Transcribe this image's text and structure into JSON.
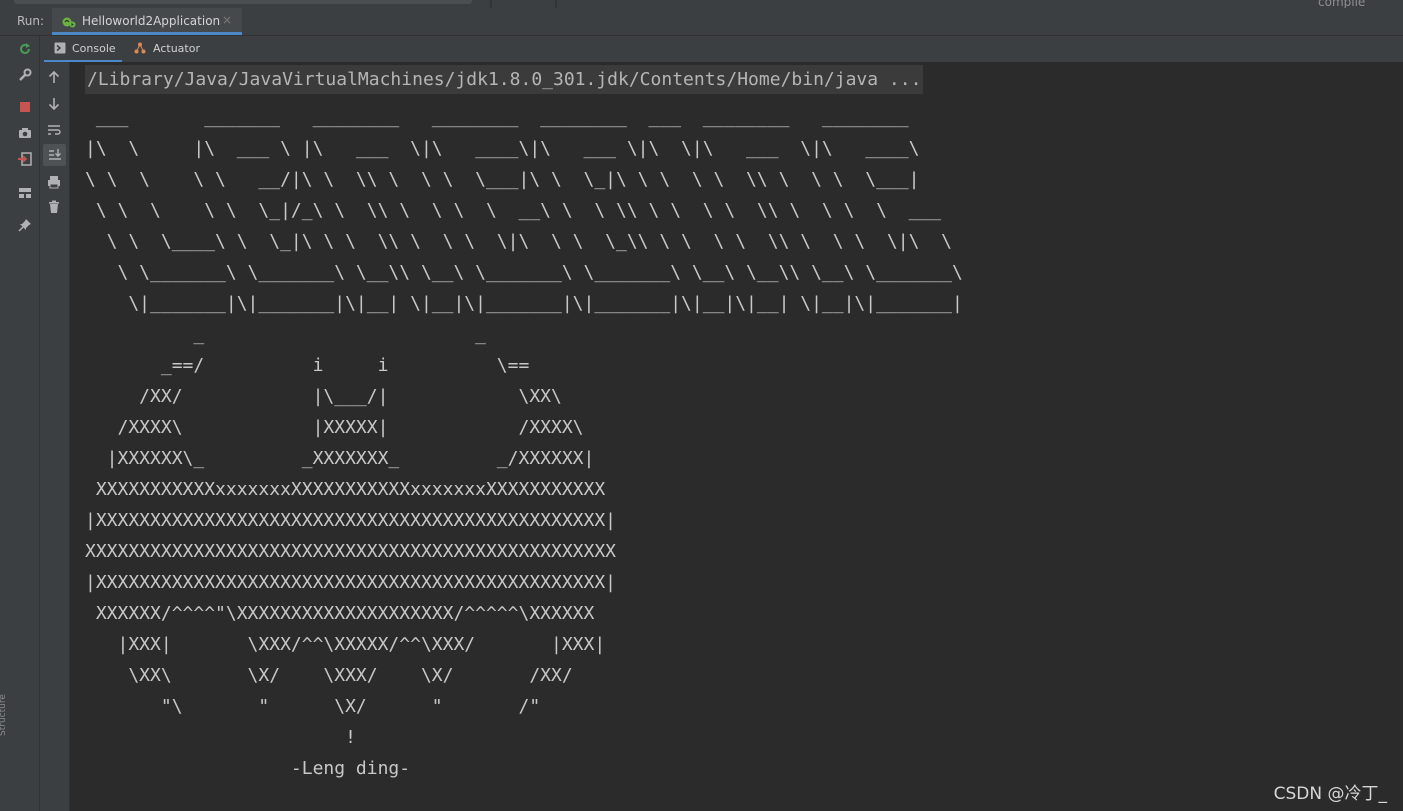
{
  "top": {
    "partial_label": "compile"
  },
  "run_bar": {
    "label": "Run:",
    "tab_title": "Helloworld2Application",
    "close_glyph": "×"
  },
  "sub_tabs": [
    {
      "label": "Console",
      "icon": "console-icon",
      "active": true
    },
    {
      "label": "Actuator",
      "icon": "actuator-icon",
      "active": false
    }
  ],
  "left_strip": {
    "label": "Structure"
  },
  "console": {
    "command": "/Library/Java/JavaVirtualMachines/jdk1.8.0_301.jdk/Contents/Home/bin/java ...",
    "banner": " ___       _______   ________   ________  ________  ___  ________   ________\n|\\  \\     |\\  ___ \\ |\\   ___  \\|\\   ____\\|\\   ___ \\|\\  \\|\\   ___  \\|\\   ____\\\n\\ \\  \\    \\ \\   __/|\\ \\  \\\\ \\  \\ \\  \\___|\\ \\  \\_|\\ \\ \\  \\ \\  \\\\ \\  \\ \\  \\___|\n \\ \\  \\    \\ \\  \\_|/_\\ \\  \\\\ \\  \\ \\  \\  __\\ \\  \\ \\\\ \\ \\  \\ \\  \\\\ \\  \\ \\  \\  ___\n  \\ \\  \\____\\ \\  \\_|\\ \\ \\  \\\\ \\  \\ \\  \\|\\  \\ \\  \\_\\\\ \\ \\  \\ \\  \\\\ \\  \\ \\  \\|\\  \\\n   \\ \\_______\\ \\_______\\ \\__\\\\ \\__\\ \\_______\\ \\_______\\ \\__\\ \\__\\\\ \\__\\ \\_______\\\n    \\|_______|\\|_______|\\|__| \\|__|\\|_______|\\|_______|\\|__|\\|__| \\|__|\\|_______|\n          _                         _\n       _==/          i     i          \\==\n     /XX/            |\\___/|            \\XX\\\n   /XXXX\\            |XXXXX|            /XXXX\\\n  |XXXXXX\\_         _XXXXXXX_         _/XXXXXX|\n XXXXXXXXXXXxxxxxxxXXXXXXXXXXXxxxxxxxXXXXXXXXXXX\n|XXXXXXXXXXXXXXXXXXXXXXXXXXXXXXXXXXXXXXXXXXXXXXX|\nXXXXXXXXXXXXXXXXXXXXXXXXXXXXXXXXXXXXXXXXXXXXXXXXX\n|XXXXXXXXXXXXXXXXXXXXXXXXXXXXXXXXXXXXXXXXXXXXXXX|\n XXXXXX/^^^^\"\\XXXXXXXXXXXXXXXXXXXX/^^^^^\\XXXXXX\n   |XXX|       \\XXX/^^\\XXXXX/^^\\XXX/       |XXX|\n    \\XX\\       \\X/    \\XXX/    \\X/       /XX/\n       \"\\       \"      \\X/      \"       /\"\n                        !\n                   -Leng ding-"
  },
  "watermark": "CSDN @冷丁_",
  "colors": {
    "background": "#2b2b2b",
    "panel": "#3c3f41",
    "accent": "#4a88c7",
    "stop": "#c75450",
    "rerun": "#499c54"
  }
}
